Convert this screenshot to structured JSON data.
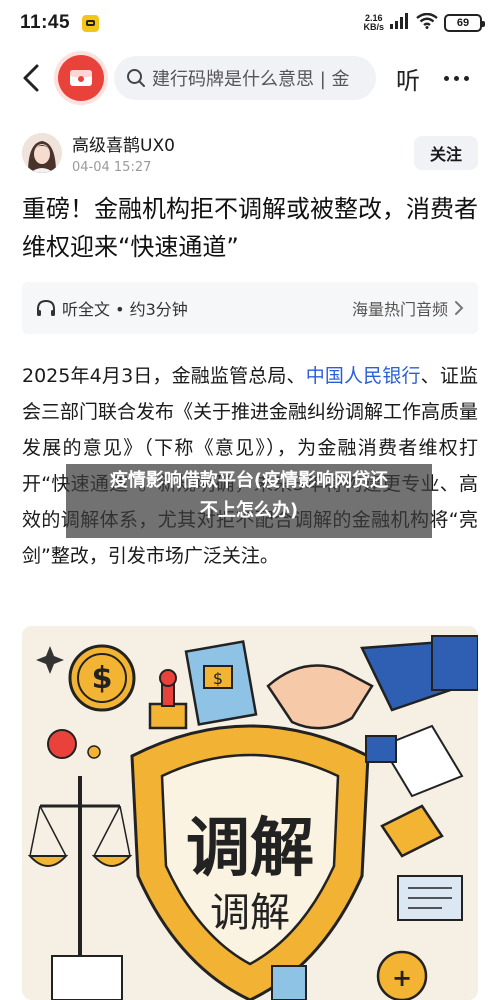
{
  "status_bar": {
    "time": "11:45",
    "net_speed_value": "2.16",
    "net_speed_unit": "KB/s",
    "battery": "69"
  },
  "nav": {
    "search_placeholder": "建行码牌是什么意思 | 金",
    "listen_label": "听"
  },
  "author": {
    "name": "高级喜鹊UX0",
    "date": "04-04 15:27",
    "follow_label": "关注"
  },
  "article": {
    "title": "重磅！金融机构拒不调解或被整改，消费者维权迎来“快速通道”",
    "audio_left": "听全文 • 约3分钟",
    "audio_right": "海量热门音频",
    "para_part1": "2025年4月3日，金融监管总局、",
    "para_link": "中国人民银行",
    "para_part2": "、证监会三部门联合发布《关于推进金融纠纷调解工作高质量发展的意见》（下称《意见》），为金融消费者维权打开“快速通道”。新规明确，未来3年将构建更专业、高效的调解体系，尤其对拒不配合调解的金融机构将“亮剑”整改，引发市场广泛关注。"
  },
  "overlay": {
    "line1": "疫情影响借款平台(疫情影响网贷还",
    "line2": "不上怎么办)"
  },
  "illustration": {
    "big_text": "调解",
    "small_text": "调解"
  },
  "colors": {
    "link": "#2b5fd9",
    "brand_red": "#e8423b",
    "shield_gold": "#f2b233"
  }
}
